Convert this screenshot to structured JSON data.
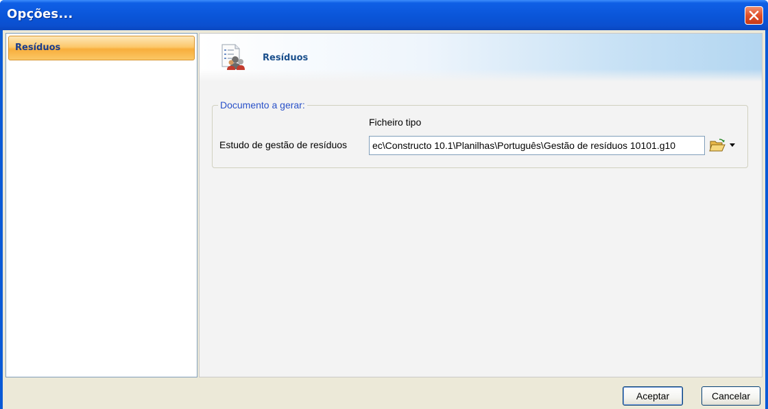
{
  "window": {
    "title": "Opções..."
  },
  "sidebar": {
    "items": [
      {
        "label": "Resíduos"
      }
    ]
  },
  "panel": {
    "header_title": "Resíduos",
    "group_title": "Documento a gerar:",
    "column_header": "Ficheiro tipo",
    "rows": [
      {
        "label": "Estudo de gestão de resíduos",
        "value": "ec\\Constructo 10.1\\Planilhas\\Português\\Gestão de resíduos 10101.g10"
      }
    ]
  },
  "buttons": {
    "ok": "Aceptar",
    "cancel": "Cancelar"
  },
  "icons": {
    "close": "close-icon",
    "header": "document-users-icon",
    "folder": "open-folder-icon",
    "dropdown": "dropdown-arrow-icon"
  },
  "colors": {
    "titlebar": "#0a55d8",
    "selection": "#f8ae3c",
    "accent_text": "#1a4f8c",
    "group_title": "#2850c8"
  }
}
